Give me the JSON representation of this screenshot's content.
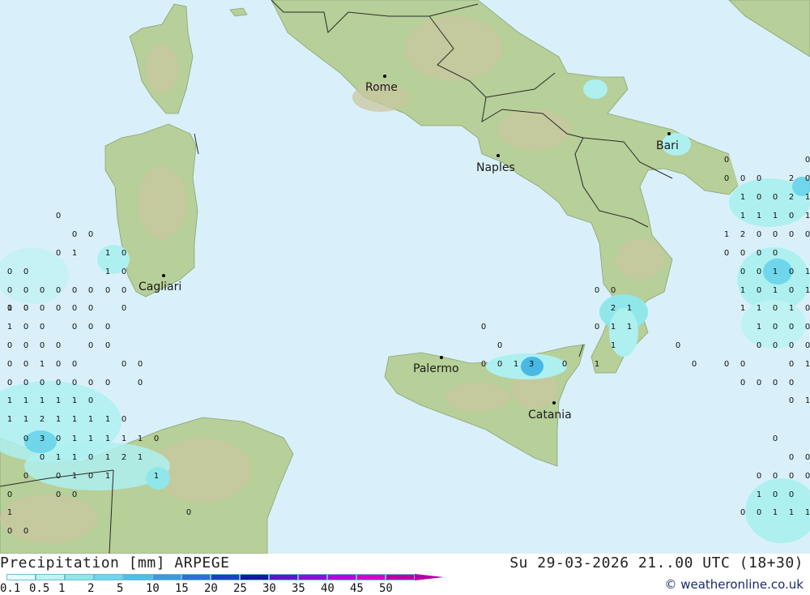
{
  "map": {
    "colors": {
      "sea": "#d9f0fa",
      "land": "#b7cf98",
      "land_high": "#c9c7a0",
      "border": "#2a2a2a",
      "precip_light": "#aef0f0",
      "precip_mid": "#6fd6ec",
      "precip_strong": "#47b9e4"
    },
    "cities": [
      {
        "id": "rome",
        "name": "Rome"
      },
      {
        "id": "naples",
        "name": "Naples"
      },
      {
        "id": "bari",
        "name": "Bari"
      },
      {
        "id": "cagliari",
        "name": "Cagliari"
      },
      {
        "id": "palermo",
        "name": "Palermo"
      },
      {
        "id": "catania",
        "name": "Catania"
      }
    ],
    "values": [
      "0",
      "0",
      "0",
      "0",
      "1",
      "1",
      "0",
      "0",
      "0",
      "1",
      "0",
      "0",
      "0",
      "0",
      "0",
      "0",
      "0",
      "0",
      "0",
      "0",
      "0",
      "1",
      "0",
      "0",
      "0",
      "0",
      "0",
      "0",
      "1",
      "0",
      "0",
      "0",
      "0",
      "0",
      "0",
      "0",
      "0",
      "0",
      "0",
      "0",
      "0",
      "0",
      "1",
      "0",
      "0",
      "0",
      "0",
      "0",
      "0",
      "0",
      "0",
      "0",
      "0",
      "0",
      "0",
      "1",
      "1",
      "1",
      "1",
      "1",
      "0",
      "1",
      "1",
      "2",
      "1",
      "1",
      "1",
      "1",
      "0",
      "0",
      "3",
      "0",
      "1",
      "1",
      "1",
      "1",
      "1",
      "0",
      "0",
      "1",
      "1",
      "0",
      "1",
      "2",
      "1",
      "0",
      "0",
      "1",
      "0",
      "1",
      "1",
      "0",
      "0",
      "0",
      "0",
      "1",
      "0",
      "0",
      "0",
      "0",
      "1",
      "3",
      "0",
      "1",
      "0",
      "0",
      "2",
      "1",
      "0",
      "1",
      "1",
      "1",
      "0",
      "0",
      "0",
      "0",
      "0",
      "0",
      "0",
      "0",
      "2",
      "0",
      "1",
      "0",
      "0",
      "2",
      "1",
      "1",
      "1",
      "1",
      "0",
      "1",
      "0",
      "1",
      "2",
      "0",
      "0",
      "0",
      "0",
      "0",
      "0",
      "0",
      "0",
      "0",
      "0",
      "1",
      "0",
      "1",
      "1",
      "0",
      "1",
      "0",
      "1",
      "1",
      "1",
      "0",
      "1",
      "0",
      "1",
      "0",
      "0",
      "0",
      "0",
      "0",
      "0",
      "0",
      "0",
      "0",
      "0",
      "1",
      "0",
      "0",
      "0",
      "0",
      "0",
      "1",
      "0",
      "0",
      "0",
      "0",
      "0",
      "0",
      "0",
      "1",
      "0",
      "0",
      "0",
      "0",
      "1",
      "1",
      "1",
      "0",
      "1"
    ]
  },
  "footer": {
    "title": "Precipitation [mm] ARPEGE",
    "valid_time": "Su 29-03-2026 21..00 UTC (18+30)",
    "credit": "© weatheronline.co.uk"
  },
  "legend": {
    "labels": [
      "0.1",
      "0.5",
      "1",
      "2",
      "5",
      "10",
      "15",
      "20",
      "25",
      "30",
      "35",
      "40",
      "45",
      "50"
    ],
    "colors": [
      "#e6fbfb",
      "#bff2f2",
      "#8fe7ea",
      "#6fd6ec",
      "#4fbfe6",
      "#3f98dc",
      "#2f6fd4",
      "#1f3fc0",
      "#15179c",
      "#5a18c8",
      "#8a10d8",
      "#b008dc",
      "#d000c8",
      "#b400a8"
    ]
  }
}
